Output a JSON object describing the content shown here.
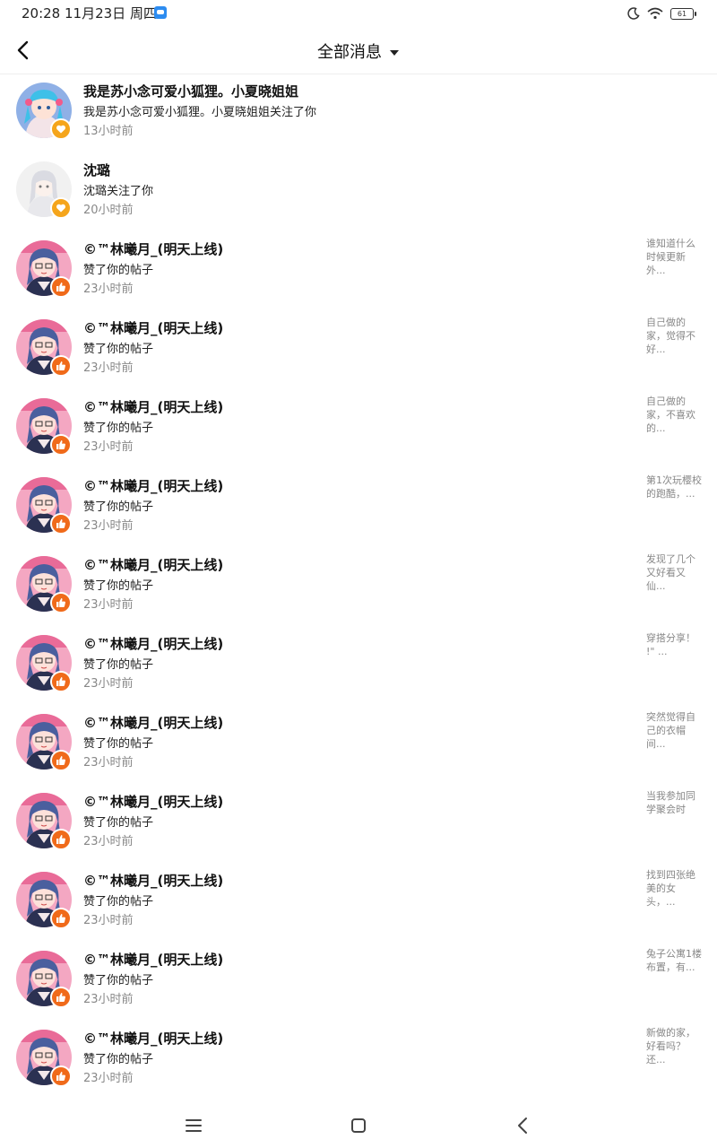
{
  "status_bar": {
    "time": "20:28 11月23日 周四",
    "battery": "61"
  },
  "header": {
    "title": "全部消息"
  },
  "messages": [
    {
      "name": "我是苏小念可爱小狐狸。小夏晓姐姐",
      "desc": "我是苏小念可爱小狐狸。小夏晓姐姐关注了你",
      "time": "13小时前",
      "type": "follow",
      "preview": ""
    },
    {
      "name": "沈璐",
      "desc": "沈璐关注了你",
      "time": "20小时前",
      "type": "follow",
      "preview": ""
    },
    {
      "name": "©™林曦月_(明天上线)",
      "desc": "赞了你的帖子",
      "time": "23小时前",
      "type": "like",
      "preview": "谁知道什么时候更新外..."
    },
    {
      "name": "©™林曦月_(明天上线)",
      "desc": "赞了你的帖子",
      "time": "23小时前",
      "type": "like",
      "preview": "自己做的家，觉得不好..."
    },
    {
      "name": "©™林曦月_(明天上线)",
      "desc": "赞了你的帖子",
      "time": "23小时前",
      "type": "like",
      "preview": "自己做的家，不喜欢的..."
    },
    {
      "name": "©™林曦月_(明天上线)",
      "desc": "赞了你的帖子",
      "time": "23小时前",
      "type": "like",
      "preview": "第1次玩樱校的跑酷，..."
    },
    {
      "name": "©™林曦月_(明天上线)",
      "desc": "赞了你的帖子",
      "time": "23小时前",
      "type": "like",
      "preview": "发现了几个又好看又仙..."
    },
    {
      "name": "©™林曦月_(明天上线)",
      "desc": "赞了你的帖子",
      "time": "23小时前",
      "type": "like",
      "preview": "穿搭分享！ !\" ..."
    },
    {
      "name": "©™林曦月_(明天上线)",
      "desc": "赞了你的帖子",
      "time": "23小时前",
      "type": "like",
      "preview": "突然觉得自己的衣帽间..."
    },
    {
      "name": "©™林曦月_(明天上线)",
      "desc": "赞了你的帖子",
      "time": "23小时前",
      "type": "like",
      "preview": "当我参加同学聚会时"
    },
    {
      "name": "©™林曦月_(明天上线)",
      "desc": "赞了你的帖子",
      "time": "23小时前",
      "type": "like",
      "preview": "找到四张绝美的女头，..."
    },
    {
      "name": "©™林曦月_(明天上线)",
      "desc": "赞了你的帖子",
      "time": "23小时前",
      "type": "like",
      "preview": "兔子公寓1楼布置，有..."
    },
    {
      "name": "©™林曦月_(明天上线)",
      "desc": "赞了你的帖子",
      "time": "23小时前",
      "type": "like",
      "preview": "新做的家，好看吗？还..."
    }
  ],
  "colors": {
    "like_badge": "#f06a1a",
    "follow_badge": "#f5a51c",
    "muted_text": "#888888"
  }
}
